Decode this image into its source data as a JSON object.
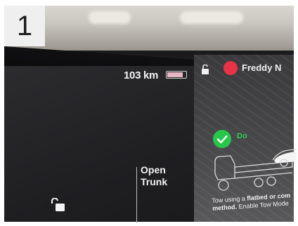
{
  "badge": {
    "number": "1"
  },
  "status_bar": {
    "range": "103 km",
    "battery_level_percent": 85,
    "profile_name": "Freddy N"
  },
  "tow_card": {
    "do_label": "Do",
    "instruction_prefix": "Tow using a ",
    "instruction_bold": "flatbed or com",
    "instruction_line2_bold": "method.",
    "instruction_line2_rest": " Enable Tow Mode"
  },
  "controls": {
    "open_trunk_line1": "Open",
    "open_trunk_line2": "Trunk"
  },
  "colors": {
    "profile_dot": "#e83246",
    "do_green": "#2fd150",
    "battery_fill": "#e7b6c3"
  },
  "icons": {
    "lock_top": "unlocked-padlock-icon",
    "lock_bottom": "unlocked-padlock-icon",
    "check": "checkmark-icon",
    "truck": "flatbed-truck-icon"
  }
}
